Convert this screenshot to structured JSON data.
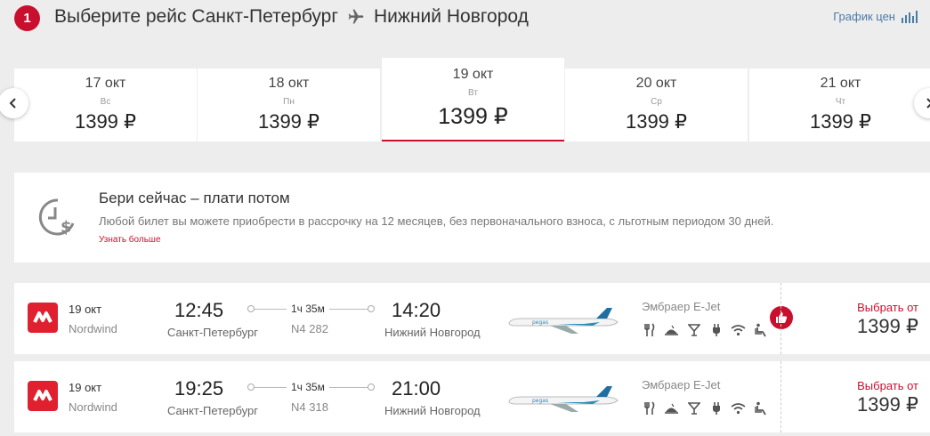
{
  "header": {
    "step": "1",
    "title_prefix": "Выберите рейс",
    "origin": "Санкт-Петербург",
    "destination": "Нижний Новгород",
    "price_chart_label": "График цен"
  },
  "dates": [
    {
      "date": "17 окт",
      "weekday": "Вс",
      "price": "1399 ₽",
      "active": false
    },
    {
      "date": "18 окт",
      "weekday": "Пн",
      "price": "1399 ₽",
      "active": false
    },
    {
      "date": "19 окт",
      "weekday": "Вт",
      "price": "1399 ₽",
      "active": true
    },
    {
      "date": "20 окт",
      "weekday": "Ср",
      "price": "1399 ₽",
      "active": false
    },
    {
      "date": "21 окт",
      "weekday": "Чт",
      "price": "1399 ₽",
      "active": false
    }
  ],
  "promo": {
    "title": "Бери сейчас – плати потом",
    "text": "Любой билет вы можете приобрести в рассрочку на 12 месяцев, без первоначального взноса, с льготным периодом 30 дней.",
    "link": "Узнать больше"
  },
  "flights": [
    {
      "date": "19 окт",
      "airline": "Nordwind",
      "dep_time": "12:45",
      "dep_city": "Санкт-Петербург",
      "duration": "1ч 35м",
      "flight_no": "N4 282",
      "arr_time": "14:20",
      "arr_city": "Нижний Новгород",
      "aircraft": "Эмбраер E-Jet",
      "recommended": true,
      "select_label": "Выбрать от",
      "price": "1399 ₽"
    },
    {
      "date": "19 окт",
      "airline": "Nordwind",
      "dep_time": "19:25",
      "dep_city": "Санкт-Петербург",
      "duration": "1ч 35м",
      "flight_no": "N4 318",
      "arr_time": "21:00",
      "arr_city": "Нижний Новгород",
      "aircraft": "Эмбраер E-Jet",
      "recommended": false,
      "select_label": "Выбрать от",
      "price": "1399 ₽"
    }
  ],
  "amenity_icons": [
    "cutlery-icon",
    "meal-icon",
    "drinks-icon",
    "power-plug-icon",
    "wifi-icon",
    "seat-icon"
  ],
  "colors": {
    "accent": "#c8102e",
    "link_blue": "#4a7ba7",
    "background": "#ededed"
  }
}
